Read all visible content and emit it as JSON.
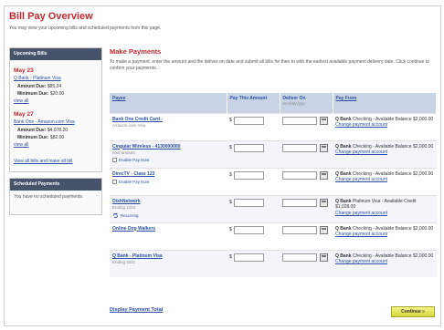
{
  "page": {
    "title": "Bill Pay Overview",
    "subtitle": "You may view your upcoming bills and scheduled payments from this page."
  },
  "upcoming": {
    "header": "Upcoming Bills",
    "bills": [
      {
        "due": "May 23",
        "payee": "Q Bank - Platinum Visa",
        "amount_label": "Amount Due:",
        "amount": "$85.24",
        "minimum_label": "Minimum Due:",
        "minimum": "$20.00",
        "link": "view all"
      },
      {
        "due": "May 27",
        "payee": "Bank One - Amazon.com Visa",
        "amount_label": "Amount Due:",
        "amount": "$4,078.20",
        "minimum_label": "Minimum Due:",
        "minimum": "$82.00",
        "link": "view all"
      }
    ],
    "view_all": "View all bills and make all bill"
  },
  "scheduled": {
    "header": "Scheduled Payments",
    "text": "You have no scheduled payments."
  },
  "make_payments": {
    "title": "Make Payments",
    "instructions": "To make a payment, enter the amount and the deliver-on date and submit all bills for then to with the earliest available payment delivery date. Click continue to confirm your payments."
  },
  "table": {
    "headers": {
      "payee": "Payee",
      "amount": "Pay This Amount",
      "deliver": "Deliver On",
      "deliver_sub": "mm/dd/yyyy",
      "payfrom": "Pay From"
    },
    "currency": "$",
    "rows": [
      {
        "payee": "Bank One Credit Card -",
        "sub": "Amazon.com Visa",
        "extra": "",
        "payfrom": "Q Bank",
        "payfrom_detail": "Checking - Available Balance $2,000.00",
        "payfrom_link": "Change payment account"
      },
      {
        "payee": "Cingular Wireless - 4130000000",
        "sub": "next amount",
        "extra": "Enable Pay Now",
        "payfrom": "Q Bank",
        "payfrom_detail": "Checking - Available Balance $2,000.00",
        "payfrom_link": "Change payment account"
      },
      {
        "payee": "DirecTV - Class 123",
        "sub": "",
        "extra": "Enable Pay Now",
        "payfrom": "Q Bank",
        "payfrom_detail": "Checking - Available Balance $2,000.00",
        "payfrom_link": "Change payment account"
      },
      {
        "payee": "DishNetwork",
        "sub": "Ending 1234",
        "extra": "Recurring",
        "payfrom": "Q Bank",
        "payfrom_detail": "Platinum Visa - Available Credit $1,028.00",
        "payfrom_link": "Change payment account"
      },
      {
        "payee": "Online Dog Walkers",
        "sub": "",
        "extra": "",
        "payfrom": "Q Bank",
        "payfrom_detail": "Checking - Available Balance $2,000.00",
        "payfrom_link": "Change payment account"
      },
      {
        "payee": "Q Bank - Platinum Visa",
        "sub": "Ending 4321",
        "extra": "",
        "payfrom": "Q Bank",
        "payfrom_detail": "Checking - Available Balance $2,000.00",
        "payfrom_link": "Change payment account"
      }
    ]
  },
  "footer": {
    "display_link": "Display Payment Total",
    "continue": "Continue »"
  },
  "colors": {
    "accent_red": "#c2272d",
    "link_blue": "#2a4fa0",
    "header_navy": "#45536b",
    "table_header": "#c9d3e6",
    "button_yellow": "#e6e65a"
  }
}
